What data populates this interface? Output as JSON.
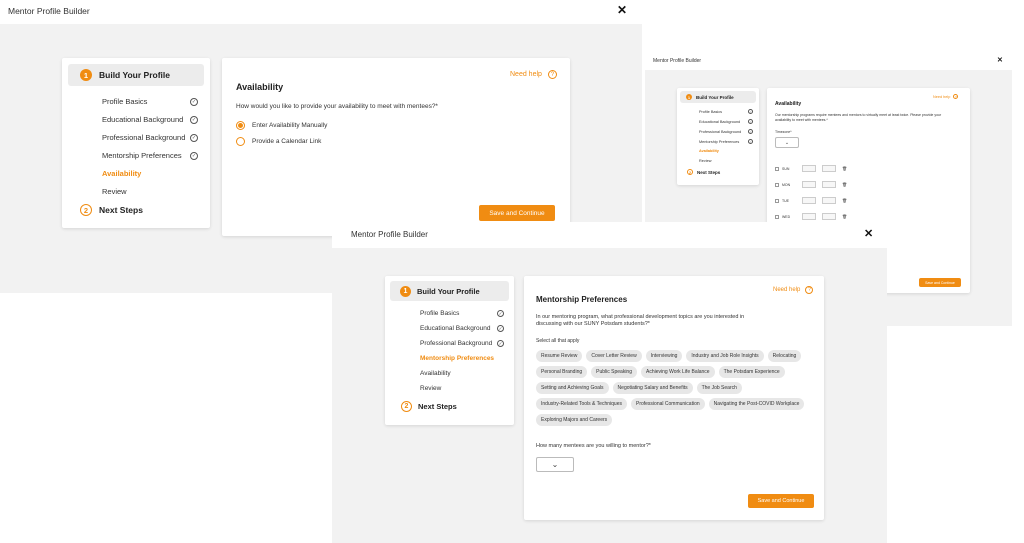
{
  "colors": {
    "accent": "#f08c12",
    "background": "#f2f2f2",
    "card": "#ffffff"
  },
  "icons": {
    "close": "close-icon",
    "check": "check-circle-icon",
    "help": "question-circle-icon",
    "chevron": "chevron-down-icon",
    "trash": "trash-icon"
  },
  "common": {
    "app_title": "Mentor Profile Builder",
    "close_glyph": "✕",
    "step1_num": "1",
    "step1": "Build Your Profile",
    "step2_num": "2",
    "step2": "Next Steps",
    "help": "Need help",
    "help_glyph": "?",
    "check_glyph": "✓",
    "chevron_glyph": "⌄",
    "trash_glyph": "🗑",
    "save": "Save and Continue"
  },
  "nav": [
    "Profile Basics",
    "Educational Background",
    "Professional Background",
    "Mentorship Preferences",
    "Availability",
    "Review"
  ],
  "window1": {
    "panel_title": "Availability",
    "question": "How would you like to provide your availability to meet with mentees?*",
    "options": [
      "Enter Availability Manually",
      "Provide a Calendar Link"
    ],
    "selected": 0
  },
  "window2": {
    "panel_title": "Availability",
    "intro": "Our mentorship programs require mentees and mentors to virtually meet at least twice. Please provide your availability to meet with mentees.*",
    "timezone_label": "Timezone*",
    "days": [
      "SUN",
      "MON",
      "TUE",
      "WED"
    ]
  },
  "window3": {
    "panel_title": "Mentorship Preferences",
    "question": "In our mentoring program, what professional development topics are you interested in discussing with our SUNY Potsdam students?*",
    "hint": "Select all that apply",
    "topics": [
      "Resume Review",
      "Cover Letter Review",
      "Interviewing",
      "Industry and Job Role Insights",
      "Relocating",
      "Personal Branding",
      "Public Speaking",
      "Achieving Work Life Balance",
      "The Potsdam Experience",
      "Setting and Achieving Goals",
      "Negotiating Salary and Benefits",
      "The Job Search",
      "Industry-Related Tools & Techniques",
      "Professional Communication",
      "Navigating the Post-COVID Workplace",
      "Exploring Majors and Careers"
    ],
    "mentees_question": "How many mentees are you willing to mentor?*"
  }
}
